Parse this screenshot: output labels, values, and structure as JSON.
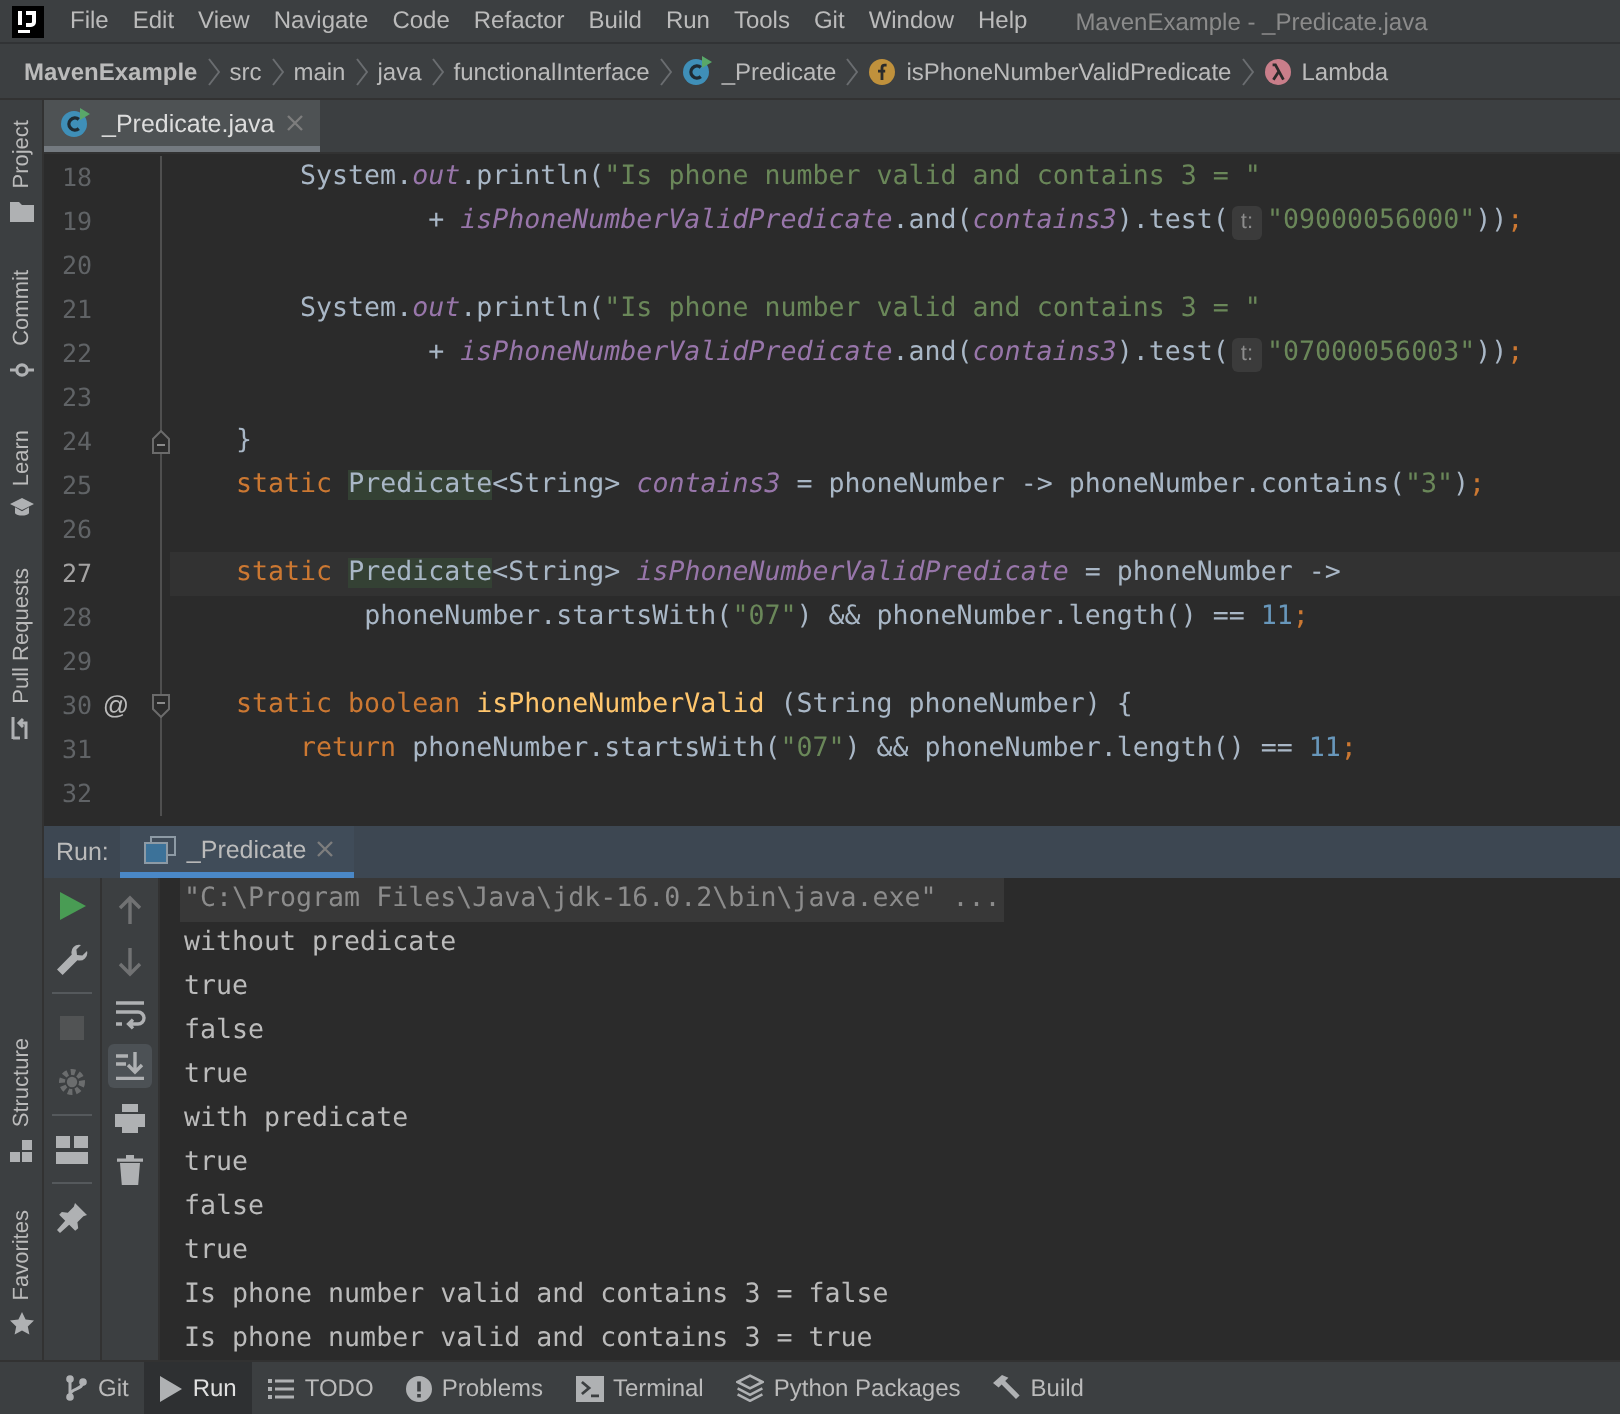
{
  "menu_bar": {
    "items": [
      "File",
      "Edit",
      "View",
      "Navigate",
      "Code",
      "Refactor",
      "Build",
      "Run",
      "Tools",
      "Git",
      "Window",
      "Help"
    ],
    "title": "MavenExample - _Predicate.java"
  },
  "breadcrumbs": [
    {
      "label": "MavenExample",
      "kind": "project"
    },
    {
      "label": "src",
      "kind": "folder"
    },
    {
      "label": "main",
      "kind": "folder"
    },
    {
      "label": "java",
      "kind": "folder"
    },
    {
      "label": "functionalInterface",
      "kind": "folder"
    },
    {
      "label": "_Predicate",
      "kind": "class"
    },
    {
      "label": "isPhoneNumberValidPredicate",
      "kind": "field"
    },
    {
      "label": "Lambda",
      "kind": "lambda"
    }
  ],
  "side_strip": {
    "top": [
      {
        "label": "Project"
      },
      {
        "label": "Commit"
      },
      {
        "label": "Learn"
      },
      {
        "label": "Pull Requests"
      }
    ],
    "bottom": [
      {
        "label": "Structure"
      },
      {
        "label": "Favorites"
      }
    ]
  },
  "editor": {
    "tabs": [
      {
        "label": "_Predicate.java",
        "selected": true
      }
    ],
    "lines": [
      {
        "number": "18",
        "current": false,
        "fold_start": false,
        "fold_end": false,
        "tokens": [
          {
            "kind": "plain",
            "text": "        System."
          },
          {
            "kind": "field",
            "text": "out"
          },
          {
            "kind": "plain",
            "text": ".println("
          },
          {
            "kind": "string",
            "text": "\"Is phone number valid and contains 3 = \""
          }
        ]
      },
      {
        "number": "19",
        "current": false,
        "fold_start": false,
        "fold_end": false,
        "tokens": [
          {
            "kind": "plain",
            "text": "                + "
          },
          {
            "kind": "field",
            "text": "isPhoneNumberValidPredicate"
          },
          {
            "kind": "plain",
            "text": ".and("
          },
          {
            "kind": "field",
            "text": "contains3"
          },
          {
            "kind": "plain",
            "text": ").test("
          },
          {
            "kind": "hint",
            "text": "t:"
          },
          {
            "kind": "string",
            "text": "\"09000056000\""
          },
          {
            "kind": "plain",
            "text": "))"
          },
          {
            "kind": "keyword",
            "text": ";"
          }
        ]
      },
      {
        "number": "20",
        "current": false,
        "fold_start": false,
        "fold_end": false
      },
      {
        "number": "21",
        "current": false,
        "fold_start": false,
        "fold_end": false,
        "tokens": [
          {
            "kind": "plain",
            "text": "        System."
          },
          {
            "kind": "field",
            "text": "out"
          },
          {
            "kind": "plain",
            "text": ".println("
          },
          {
            "kind": "string",
            "text": "\"Is phone number valid and contains 3 = \""
          }
        ]
      },
      {
        "number": "22",
        "current": false,
        "fold_start": false,
        "fold_end": false,
        "tokens": [
          {
            "kind": "plain",
            "text": "                + "
          },
          {
            "kind": "field",
            "text": "isPhoneNumberValidPredicate"
          },
          {
            "kind": "plain",
            "text": ".and("
          },
          {
            "kind": "field",
            "text": "contains3"
          },
          {
            "kind": "plain",
            "text": ").test("
          },
          {
            "kind": "hint",
            "text": "t:"
          },
          {
            "kind": "string",
            "text": "\"07000056003\""
          },
          {
            "kind": "plain",
            "text": "))"
          },
          {
            "kind": "keyword",
            "text": ";"
          }
        ]
      },
      {
        "number": "23",
        "current": false,
        "fold_start": false,
        "fold_end": false
      },
      {
        "number": "24",
        "current": false,
        "fold_start": false,
        "fold_end": true,
        "tokens": [
          {
            "kind": "plain",
            "text": "    }"
          }
        ]
      },
      {
        "number": "25",
        "current": false,
        "fold_start": false,
        "fold_end": false,
        "tokens": [
          {
            "kind": "keyword",
            "text": "    static "
          },
          {
            "kind": "type",
            "text": "Predicate"
          },
          {
            "kind": "plain",
            "text": "<String> "
          },
          {
            "kind": "field",
            "text": "contains3"
          },
          {
            "kind": "plain",
            "text": " = phoneNumber -> phoneNumber.contains("
          },
          {
            "kind": "string",
            "text": "\"3\""
          },
          {
            "kind": "plain",
            "text": ")"
          },
          {
            "kind": "keyword",
            "text": ";"
          }
        ]
      },
      {
        "number": "26",
        "current": false,
        "fold_start": false,
        "fold_end": false
      },
      {
        "number": "27",
        "current": true,
        "fold_start": false,
        "fold_end": false,
        "tokens": [
          {
            "kind": "keyword",
            "text": "    static "
          },
          {
            "kind": "type",
            "text": "Predicate"
          },
          {
            "kind": "plain",
            "text": "<String> "
          },
          {
            "kind": "field",
            "text": "isPhoneNumberValidPredicate"
          },
          {
            "kind": "plain",
            "text": " = phoneNumber ->"
          }
        ]
      },
      {
        "number": "28",
        "current": false,
        "fold_start": false,
        "fold_end": false,
        "tokens": [
          {
            "kind": "plain",
            "text": "            phoneNumber.startsWith("
          },
          {
            "kind": "string",
            "text": "\"07\""
          },
          {
            "kind": "plain",
            "text": ") && phoneNumber.length() == "
          },
          {
            "kind": "number",
            "text": "11"
          },
          {
            "kind": "keyword",
            "text": ";"
          }
        ]
      },
      {
        "number": "29",
        "current": false,
        "fold_start": false,
        "fold_end": false
      },
      {
        "number": "30",
        "current": false,
        "marker": "@",
        "fold_start": true,
        "fold_end": false,
        "tokens": [
          {
            "kind": "keyword",
            "text": "    static boolean "
          },
          {
            "kind": "method",
            "text": "isPhoneNumberValid"
          },
          {
            "kind": "plain",
            "text": " (String phoneNumber) {"
          }
        ]
      },
      {
        "number": "31",
        "current": false,
        "fold_start": false,
        "fold_end": false,
        "tokens": [
          {
            "kind": "keyword",
            "text": "        return "
          },
          {
            "kind": "plain",
            "text": "phoneNumber.startsWith("
          },
          {
            "kind": "string",
            "text": "\"07\""
          },
          {
            "kind": "plain",
            "text": ") && phoneNumber.length() == "
          },
          {
            "kind": "number",
            "text": "11"
          },
          {
            "kind": "keyword",
            "text": ";"
          }
        ]
      },
      {
        "number": "32",
        "current": false,
        "fold_start": false,
        "fold_end": false
      }
    ]
  },
  "run_panel": {
    "label": "Run:",
    "tabs": [
      {
        "label": "_Predicate",
        "selected": true
      }
    ],
    "toolbar": {
      "primary": [
        [
          {
            "disabled": false
          },
          {
            "disabled": false
          }
        ],
        [
          {
            "disabled": true
          },
          {
            "disabled": true
          }
        ],
        [
          {
            "disabled": false
          }
        ],
        [
          {
            "disabled": false
          }
        ]
      ],
      "secondary": [
        {
          "disabled": true,
          "on": false
        },
        {
          "disabled": true,
          "on": false
        },
        {
          "disabled": false,
          "on": false
        },
        {
          "disabled": false,
          "on": true
        },
        {
          "disabled": false,
          "on": false
        },
        {
          "disabled": false,
          "on": false
        }
      ]
    },
    "output": [
      {
        "kind": "command",
        "text": "\"C:\\Program Files\\Java\\jdk-16.0.2\\bin\\java.exe\" ..."
      },
      {
        "kind": "output",
        "text": "without predicate"
      },
      {
        "kind": "output",
        "text": "true"
      },
      {
        "kind": "output",
        "text": "false"
      },
      {
        "kind": "output",
        "text": "true"
      },
      {
        "kind": "output",
        "text": "with predicate"
      },
      {
        "kind": "output",
        "text": "true"
      },
      {
        "kind": "output",
        "text": "false"
      },
      {
        "kind": "output",
        "text": "true"
      },
      {
        "kind": "output",
        "text": "Is phone number valid and contains 3 = false"
      },
      {
        "kind": "output",
        "text": "Is phone number valid and contains 3 = true"
      }
    ]
  },
  "tool_window_bar": [
    {
      "label": "Git",
      "selected": false
    },
    {
      "label": "Run",
      "selected": true
    },
    {
      "label": "TODO",
      "selected": false
    },
    {
      "label": "Problems",
      "selected": false
    },
    {
      "label": "Terminal",
      "selected": false
    },
    {
      "label": "Python Packages",
      "selected": false
    },
    {
      "label": "Build",
      "selected": false
    }
  ]
}
